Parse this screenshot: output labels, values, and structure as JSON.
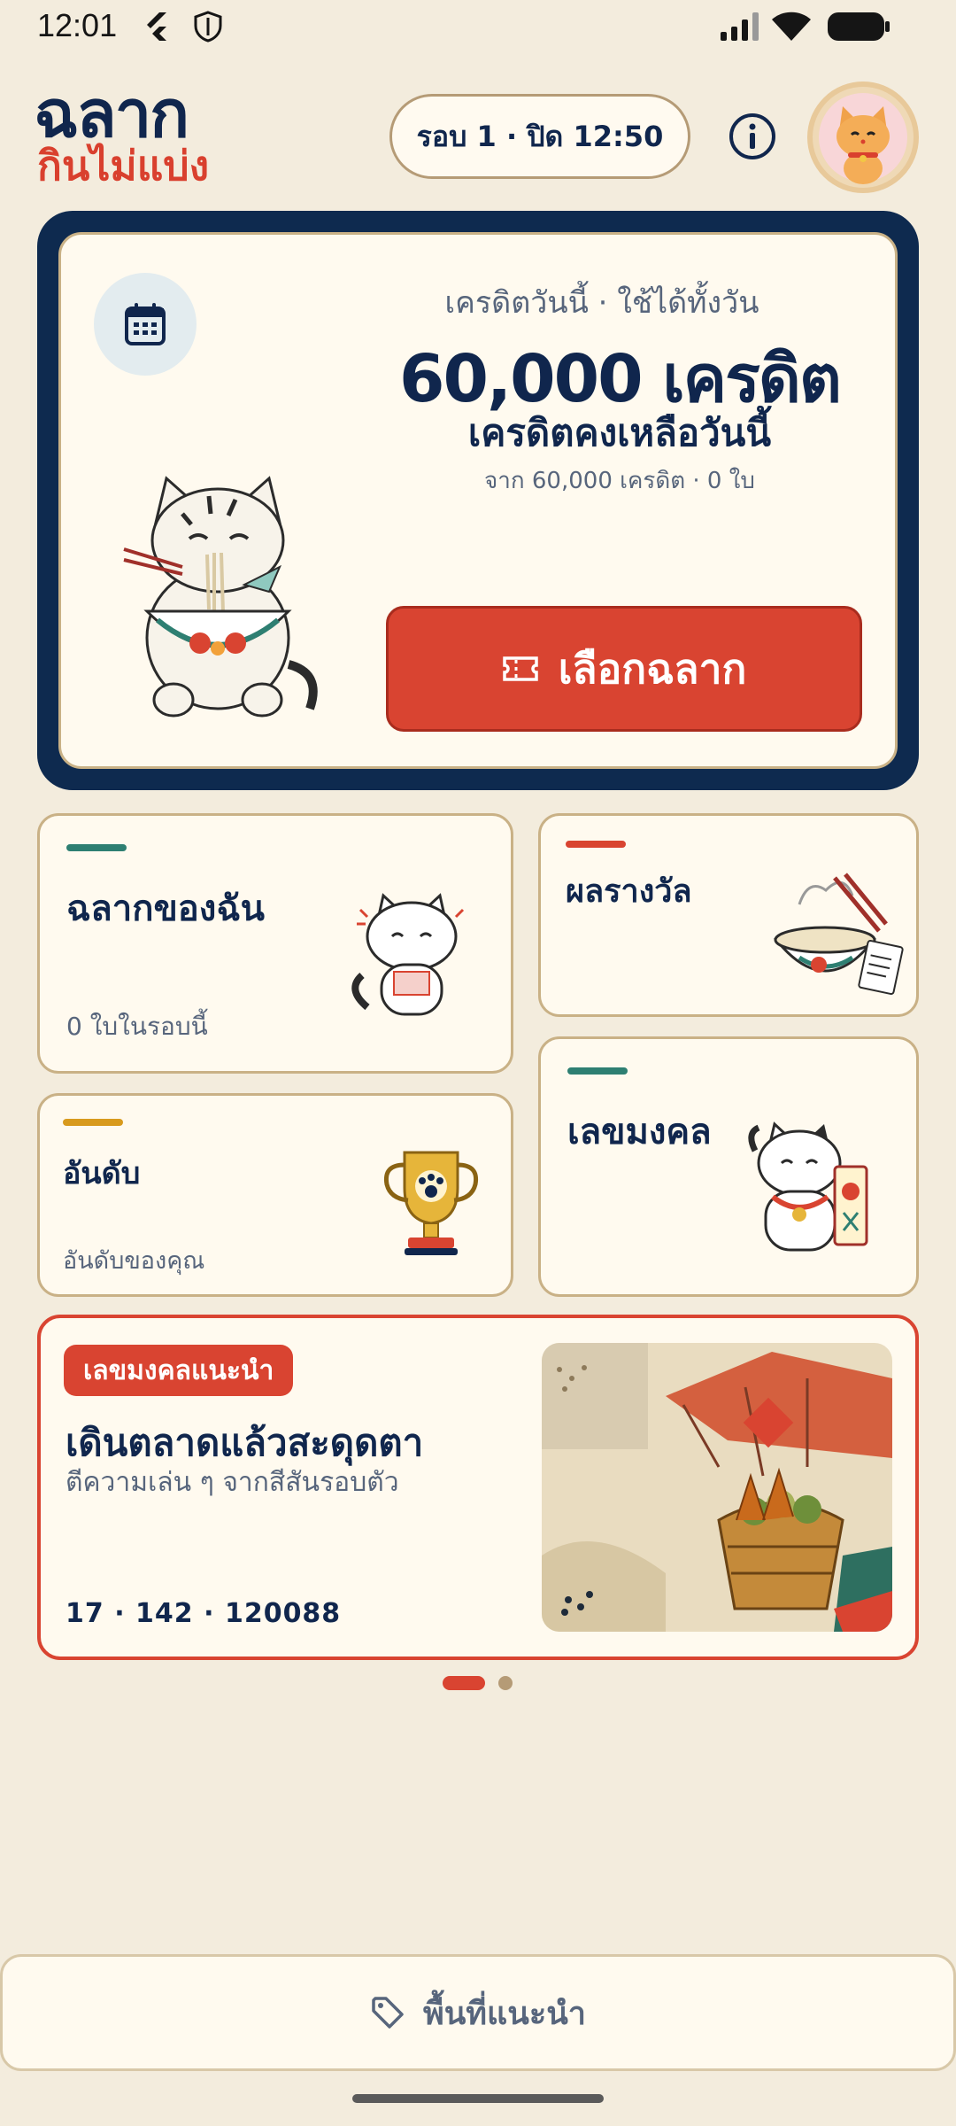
{
  "status_bar": {
    "time": "12:01"
  },
  "header": {
    "logo_main": "ฉลาก",
    "logo_sub": "กินไม่แบ่ง",
    "round_label": "รอบ 1 · ปิด 12:50"
  },
  "hero": {
    "subtitle": "เครดิตวันนี้ · ใช้ได้ทั้งวัน",
    "credit": "60,000 เครดิต",
    "remaining_label": "เครดิตคงเหลือวันนี้",
    "from_label": "จาก 60,000 เครดิต · 0 ใบ",
    "choose_button": "เลือกฉลาก"
  },
  "tiles": {
    "my_tickets": {
      "title": "ฉลากของฉัน",
      "sub": "0 ใบในรอบนี้",
      "accent": "#2e7f72"
    },
    "results": {
      "title": "ผลรางวัล",
      "accent": "#d94431"
    },
    "ranking": {
      "title": "อันดับ",
      "sub": "อันดับของคุณ",
      "accent": "#d89a1d"
    },
    "lucky": {
      "title": "เลขมงคล",
      "accent": "#2e7f72"
    }
  },
  "featured": {
    "badge": "เลขมงคลแนะนำ",
    "title": "เดินตลาดแล้วสะดุดตา",
    "desc": "ตีความเล่น ๆ จากสีสันรอบตัว",
    "numbers": "17 · 142 · 120088"
  },
  "bottom": {
    "label": "พื้นที่แนะนำ"
  },
  "colors": {
    "primary": "#10264d",
    "accent": "#d94431",
    "background": "#f3ecdd"
  }
}
